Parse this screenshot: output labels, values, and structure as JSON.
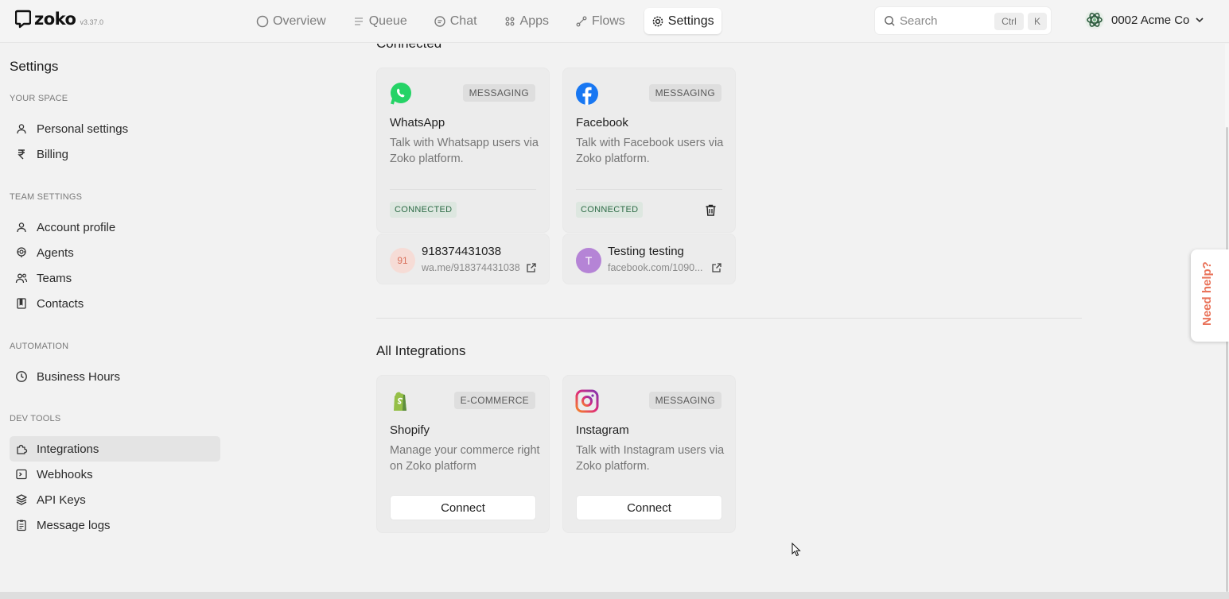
{
  "app": {
    "name": "zoko",
    "version": "v3.37.0"
  },
  "nav": {
    "items": [
      {
        "label": "Overview",
        "icon": "circle-icon"
      },
      {
        "label": "Queue",
        "icon": "queue-icon"
      },
      {
        "label": "Chat",
        "icon": "chat-icon"
      },
      {
        "label": "Apps",
        "icon": "apps-icon"
      },
      {
        "label": "Flows",
        "icon": "flows-icon"
      },
      {
        "label": "Settings",
        "icon": "gear-icon",
        "active": true
      }
    ]
  },
  "search": {
    "placeholder": "Search",
    "shortcut_ctrl": "Ctrl",
    "shortcut_key": "K"
  },
  "account": {
    "name": "0002 Acme Co"
  },
  "sidebar": {
    "title": "Settings",
    "sections": [
      {
        "label": "YOUR SPACE",
        "items": [
          {
            "label": "Personal settings",
            "icon": "user-icon"
          },
          {
            "label": "Billing",
            "icon": "rupee-icon"
          }
        ]
      },
      {
        "label": "TEAM SETTINGS",
        "items": [
          {
            "label": "Account profile",
            "icon": "user-icon"
          },
          {
            "label": "Agents",
            "icon": "agent-icon"
          },
          {
            "label": "Teams",
            "icon": "users-icon"
          },
          {
            "label": "Contacts",
            "icon": "book-icon"
          }
        ]
      },
      {
        "label": "AUTOMATION",
        "items": [
          {
            "label": "Business Hours",
            "icon": "clock-icon"
          }
        ]
      },
      {
        "label": "DEV TOOLS",
        "items": [
          {
            "label": "Integrations",
            "icon": "puzzle-icon",
            "active": true
          },
          {
            "label": "Webhooks",
            "icon": "terminal-icon"
          },
          {
            "label": "API Keys",
            "icon": "layers-icon"
          },
          {
            "label": "Message logs",
            "icon": "clipboard-icon"
          }
        ]
      }
    ]
  },
  "connected": {
    "title": "Connected",
    "cards": [
      {
        "name": "WhatsApp",
        "tag": "MESSAGING",
        "description": "Talk with Whatsapp users via Zoko platform.",
        "status": "CONNECTED",
        "icon": "whatsapp-icon",
        "account": {
          "avatar": "91",
          "name": "918374431038",
          "link": "wa.me/918374431038"
        }
      },
      {
        "name": "Facebook",
        "tag": "MESSAGING",
        "description": "Talk with Facebook users via Zoko platform.",
        "status": "CONNECTED",
        "icon": "facebook-icon",
        "account": {
          "avatar": "T",
          "name": "Testing testing",
          "link": "facebook.com/1090..."
        }
      }
    ]
  },
  "all_integrations": {
    "title": "All Integrations",
    "cards": [
      {
        "name": "Shopify",
        "tag": "E-COMMERCE",
        "description": "Manage your commerce right on Zoko platform",
        "button": "Connect",
        "icon": "shopify-icon"
      },
      {
        "name": "Instagram",
        "tag": "MESSAGING",
        "description": "Talk with Instagram users via Zoko platform.",
        "button": "Connect",
        "icon": "instagram-icon"
      }
    ]
  },
  "help": {
    "label": "Need help?"
  },
  "colors": {
    "whatsapp": "#25d366",
    "facebook": "#1877f2",
    "shopify": "#95bf47",
    "instagram": "#c13584",
    "connected_badge": "#2d6b46",
    "help_accent": "#e9735a"
  }
}
